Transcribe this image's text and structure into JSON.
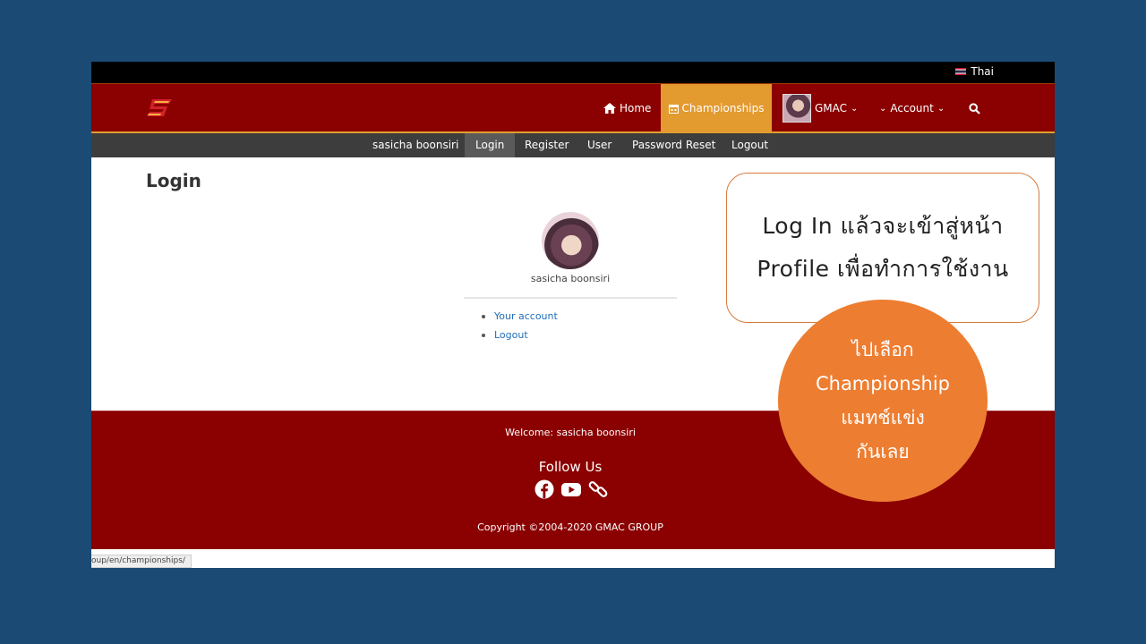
{
  "top_bar": {
    "language": "Thai"
  },
  "main_nav": {
    "home": "Home",
    "championships": "Championships",
    "user": "GMAC",
    "account": "Account"
  },
  "sub_nav": [
    "sasicha boonsiri",
    "Login",
    "Register",
    "User",
    "Password Reset",
    "Logout"
  ],
  "page": {
    "title": "Login",
    "profile_name": "sasicha boonsiri",
    "links": [
      "Your account",
      "Logout"
    ]
  },
  "footer": {
    "welcome": "Welcome: sasicha boonsiri",
    "follow_us": "Follow Us",
    "copyright": "Copyright ©2004-2020 GMAC GROUP"
  },
  "status_url": "oup/en/championships/",
  "callout": {
    "line1": "Log In แล้วจะเข้าสู่หน้า",
    "line2": "Profile เพื่อทำการใช้งาน"
  },
  "circle_note": [
    "ไปเลือก",
    "Championship",
    "แมทช์แข่ง",
    "กันเลย"
  ],
  "colors": {
    "slide_bg": "#1b4a75",
    "nav_red": "#8b0000",
    "active_tab": "#e39a2f",
    "subnav": "#3d3d3d",
    "callout_orange": "#ed7d31",
    "link_blue": "#1f6fb5"
  },
  "icons": [
    "home-icon",
    "calendar-icon",
    "chevron-down-icon",
    "search-icon",
    "facebook-icon",
    "youtube-icon",
    "link-icon"
  ]
}
